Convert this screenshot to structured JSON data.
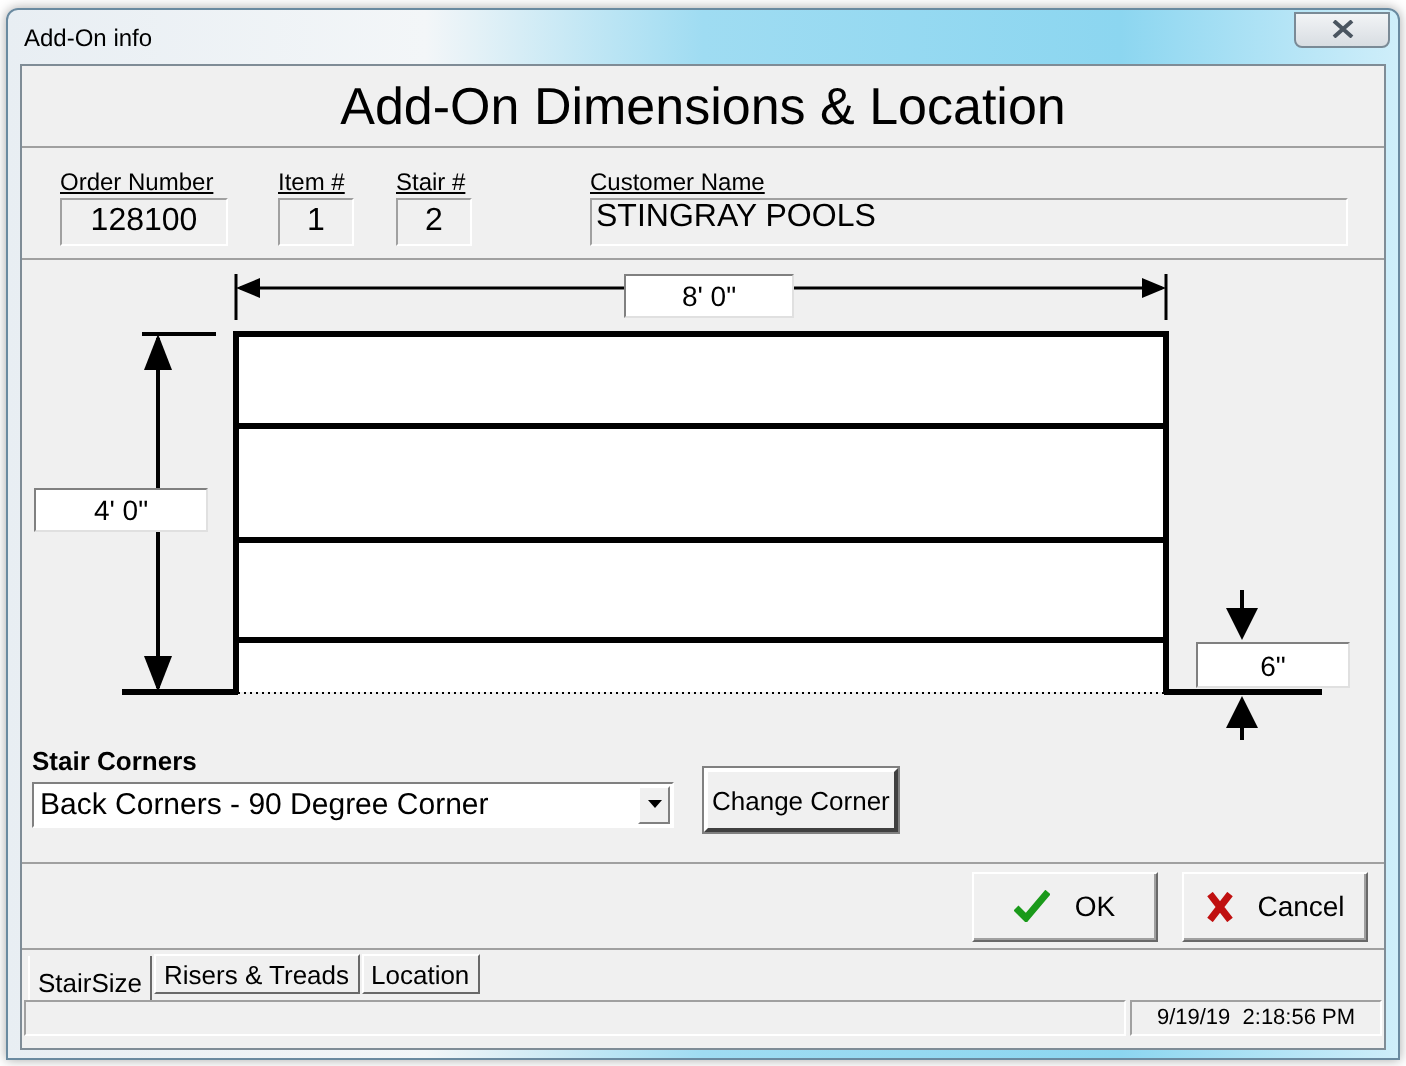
{
  "window": {
    "title": "Add-On info"
  },
  "heading": "Add-On Dimensions & Location",
  "fields": [
    {
      "label": "Order Number",
      "value": "128100"
    },
    {
      "label": "Item #",
      "value": "1"
    },
    {
      "label": "Stair #",
      "value": "2"
    },
    {
      "label": "Customer Name",
      "value": "STINGRAY POOLS"
    }
  ],
  "diagram": {
    "width": "8' 0\"",
    "height": "4' 0\"",
    "step_height": "6\""
  },
  "stair_corners": {
    "label": "Stair Corners",
    "value": "Back Corners - 90 Degree Corner"
  },
  "change_corner_button": "Change Corner",
  "buttons": [
    {
      "kind": "ok",
      "label": "OK"
    },
    {
      "kind": "cancel",
      "label": "Cancel"
    }
  ],
  "tabs": [
    {
      "label": "StairSize",
      "selected": true
    },
    {
      "label": "Risers & Treads",
      "selected": false
    },
    {
      "label": "Location",
      "selected": false
    }
  ],
  "status_bar": {
    "datetime": "9/19/19  2:18:56 PM"
  }
}
